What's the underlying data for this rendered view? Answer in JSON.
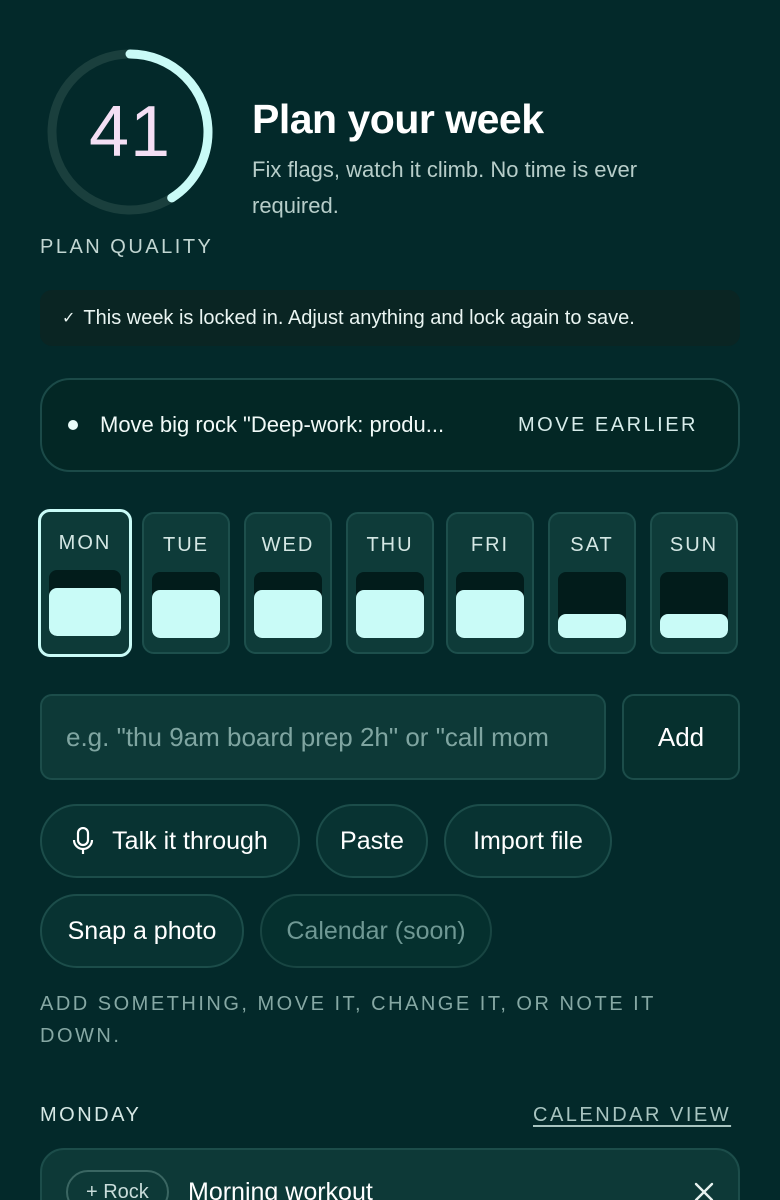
{
  "score": {
    "value": "41",
    "label": "PLAN QUALITY",
    "progress": 0.41,
    "arc_color": "#c9fbf7",
    "track_color": "#1a3f3d"
  },
  "header": {
    "title": "Plan your week",
    "subtitle": "Fix flags, watch it climb. No time is ever required."
  },
  "banner": {
    "check_icon": "check-icon",
    "text": "This week is locked in. Adjust anything and lock again to save."
  },
  "suggestion": {
    "text": "Move big rock \"Deep-work: produ...",
    "action": "MOVE EARLIER"
  },
  "days": [
    {
      "label": "MON",
      "fill": 0.72,
      "active": true
    },
    {
      "label": "TUE",
      "fill": 0.72,
      "active": false
    },
    {
      "label": "WED",
      "fill": 0.72,
      "active": false
    },
    {
      "label": "THU",
      "fill": 0.72,
      "active": false
    },
    {
      "label": "FRI",
      "fill": 0.72,
      "active": false
    },
    {
      "label": "SAT",
      "fill": 0.36,
      "active": false
    },
    {
      "label": "SUN",
      "fill": 0.36,
      "active": false
    }
  ],
  "input": {
    "placeholder": "e.g. \"thu 9am board prep 2h\" or \"call mom",
    "value": "",
    "add_label": "Add"
  },
  "actions": {
    "talk": "Talk it through",
    "paste": "Paste",
    "import": "Import file",
    "snap": "Snap a photo",
    "calendar": "Calendar (soon)"
  },
  "hint": "ADD SOMETHING, MOVE IT, CHANGE IT, OR NOTE IT DOWN.",
  "section": {
    "title": "MONDAY",
    "calendar_link": "CALENDAR VIEW"
  },
  "event": {
    "tag": "+ Rock",
    "title": "Morning workout"
  },
  "colors": {
    "background": "#03292a",
    "accent": "#c9fbf7",
    "score_text": "#f4dff4"
  }
}
